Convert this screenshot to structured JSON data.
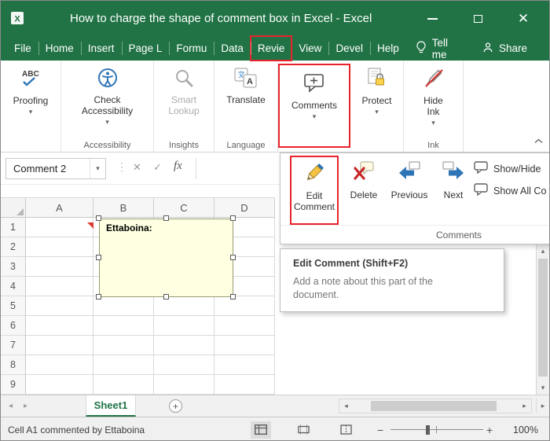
{
  "colors": {
    "excel_green": "#217346",
    "annotation_red": "#e8232b",
    "comment_fill": "#ffffe1",
    "selected_sheet_green": "#217346"
  },
  "titlebar": {
    "title": "How to charge the shape of comment box in Excel - Excel"
  },
  "icons": {
    "close": "✕",
    "chevron_down": "▾",
    "dots": "⋮",
    "cancel": "✕",
    "enter": "✓",
    "scroll_up": "▴",
    "scroll_down": "▾",
    "scroll_left": "◂",
    "scroll_right": "▸",
    "add_sheet": "+",
    "zoom_out": "−",
    "zoom_in": "+"
  },
  "tabs": {
    "items": [
      "File",
      "Home",
      "Insert",
      "Page L",
      "Formu",
      "Data",
      "Revie",
      "View",
      "Devel",
      "Help"
    ],
    "tell_me": "Tell me",
    "share": "Share"
  },
  "ribbon": {
    "proofing_label": "Proofing",
    "check_accessibility_label": "Check Accessibility",
    "accessibility_group_label": "Accessibility",
    "smart_lookup_label": "Smart Lookup",
    "insights_group_label": "Insights",
    "translate_label": "Translate",
    "language_group_label": "Language",
    "comments_label": "Comments",
    "protect_label": "Protect",
    "hide_ink_label": "Hide Ink",
    "ink_group_label": "Ink"
  },
  "formula_bar": {
    "name_box_value": "Comment 2",
    "fx_label": "fx"
  },
  "comments_menu": {
    "items": [
      "Edit Comment",
      "Delete",
      "Previous",
      "Next",
      "Show/Hide",
      "Show All Co"
    ],
    "group_label": "Comments"
  },
  "tooltip": {
    "title": "Edit Comment (Shift+F2)",
    "body": "Add a note about this part of the document."
  },
  "grid": {
    "column_headers": [
      "A",
      "B",
      "C",
      "D"
    ],
    "row_headers": [
      "1",
      "2",
      "3",
      "4",
      "5",
      "6",
      "7",
      "8",
      "9"
    ],
    "comment_text": "Ettaboina:"
  },
  "sheet_bar": {
    "sheet_tab": "Sheet1"
  },
  "status_bar": {
    "message": "Cell A1 commented by Ettaboina",
    "zoom_level": "100%"
  }
}
